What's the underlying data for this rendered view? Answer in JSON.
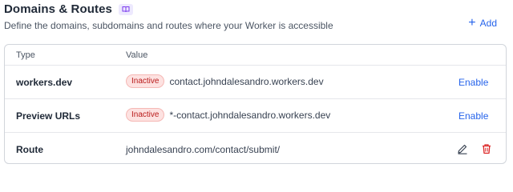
{
  "header": {
    "title": "Domains & Routes",
    "subtitle": "Define the domains, subdomains and routes where your Worker is accessible",
    "docs_icon": "book-icon",
    "add_label": "Add",
    "accent_color": "#2563eb"
  },
  "table": {
    "columns": [
      "Type",
      "Value"
    ],
    "rows": [
      {
        "type": "workers.dev",
        "status": "Inactive",
        "value": "contact.johndalesandro.workers.dev",
        "action": "Enable"
      },
      {
        "type": "Preview URLs",
        "status": "Inactive",
        "value": "*-contact.johndalesandro.workers.dev",
        "action": "Enable"
      },
      {
        "type": "Route",
        "value": "johndalesandro.com/contact/submit/",
        "icons": [
          "pencil-icon",
          "trash-icon"
        ]
      }
    ]
  },
  "colors": {
    "inactive_bg": "#fde2e1",
    "inactive_text": "#b91c1c",
    "delete_icon": "#dc2626"
  }
}
